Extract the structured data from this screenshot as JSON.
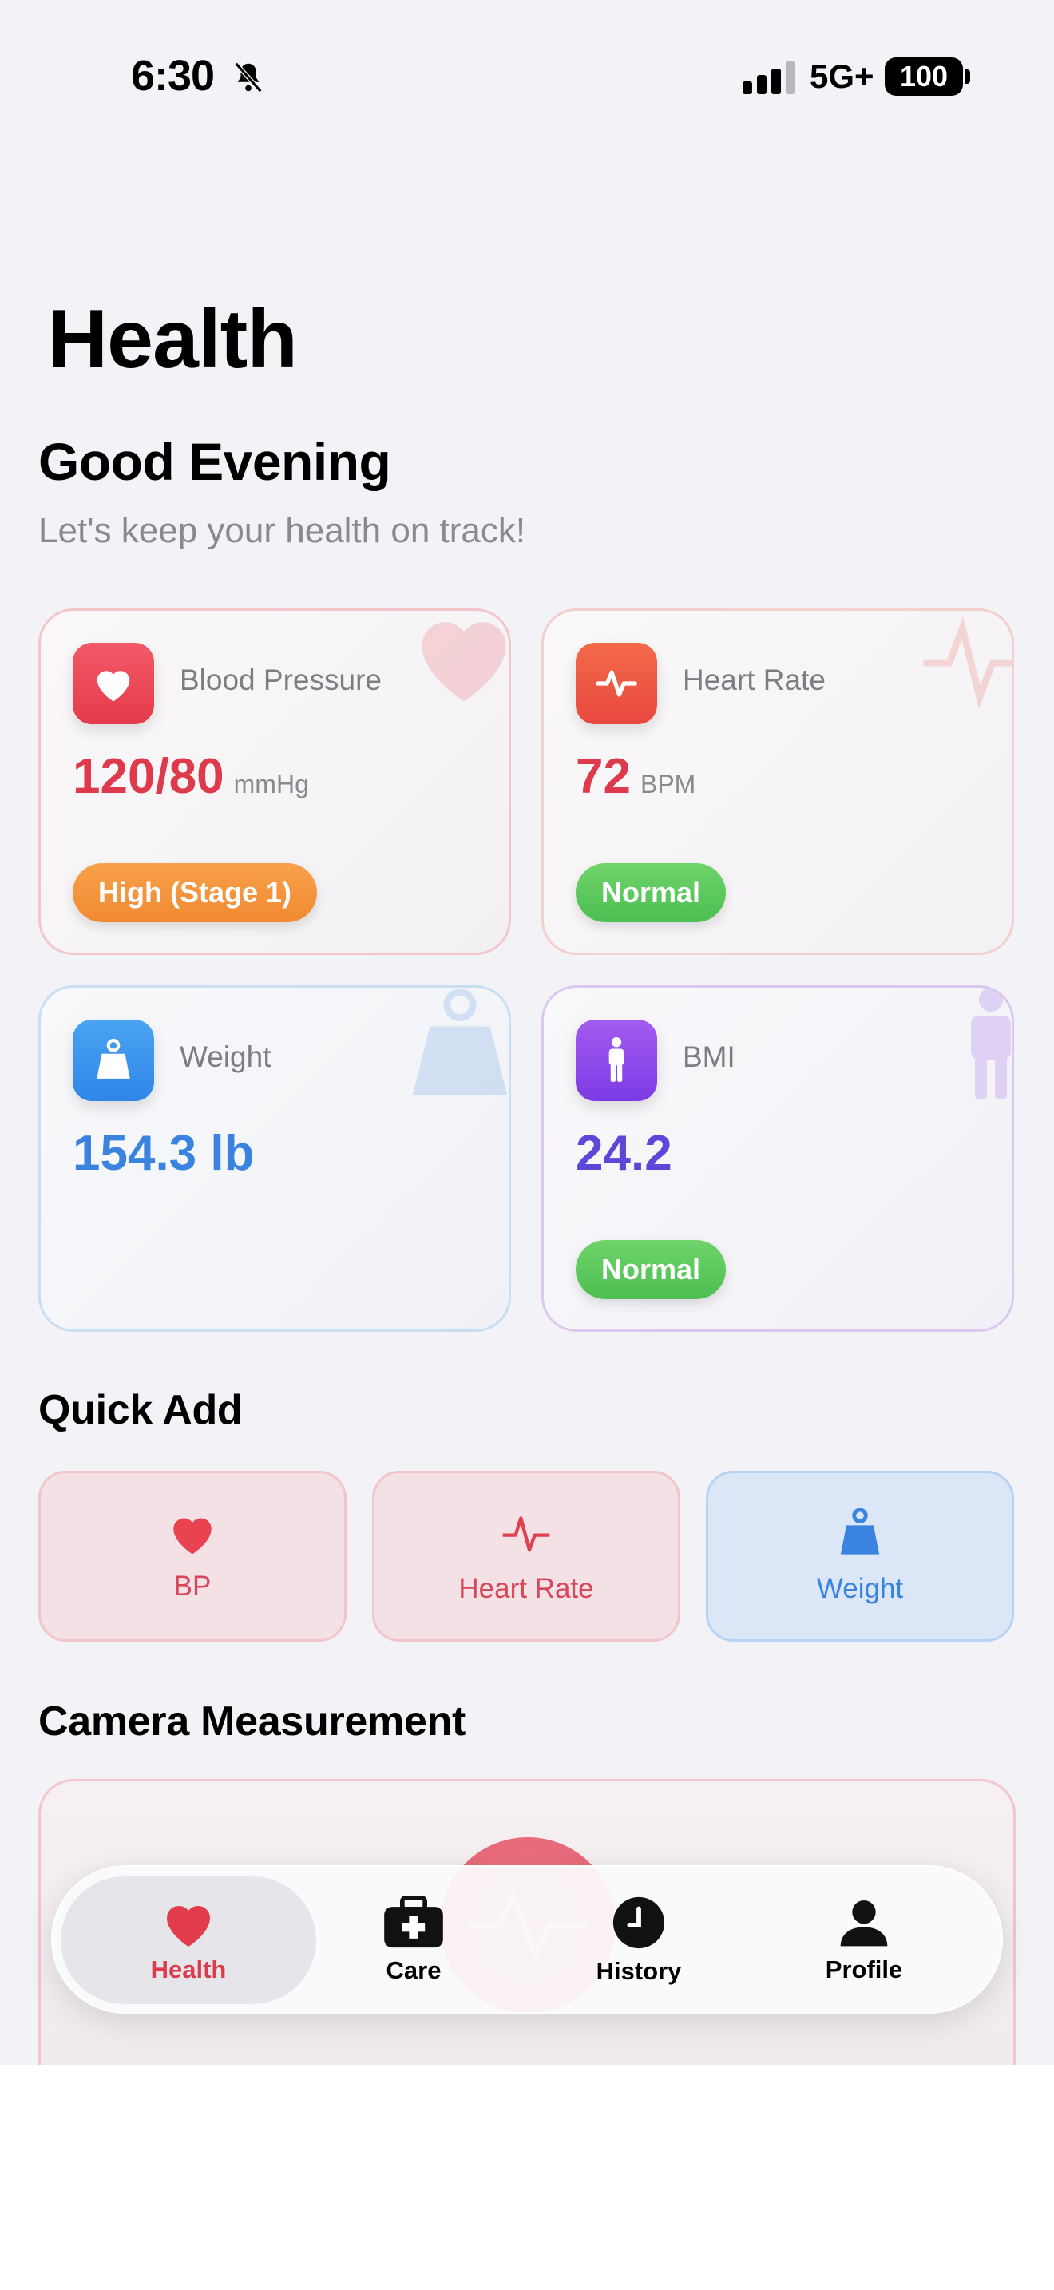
{
  "status_bar": {
    "time": "6:30",
    "network": "5G+",
    "battery": "100"
  },
  "page_title": "Health",
  "greeting": "Good Evening",
  "subtitle": "Let's keep your health on track!",
  "metrics": {
    "blood_pressure": {
      "label": "Blood Pressure",
      "value": "120/80",
      "unit": "mmHg",
      "status": "High (Stage 1)",
      "icon": "heart-icon"
    },
    "heart_rate": {
      "label": "Heart Rate",
      "value": "72",
      "unit": "BPM",
      "status": "Normal",
      "icon": "pulse-icon"
    },
    "weight": {
      "label": "Weight",
      "value": "154.3 lb",
      "icon": "weight-icon"
    },
    "bmi": {
      "label": "BMI",
      "value": "24.2",
      "status": "Normal",
      "icon": "person-icon"
    }
  },
  "quick_add": {
    "title": "Quick Add",
    "items": [
      {
        "label": "BP",
        "icon": "heart-icon"
      },
      {
        "label": "Heart Rate",
        "icon": "pulse-icon"
      },
      {
        "label": "Weight",
        "icon": "weight-icon"
      }
    ]
  },
  "camera": {
    "title": "Camera Measurement"
  },
  "tabs": [
    {
      "label": "Health",
      "icon": "heart-icon",
      "active": true
    },
    {
      "label": "Care",
      "icon": "medkit-icon"
    },
    {
      "label": "History",
      "icon": "clock-icon"
    },
    {
      "label": "Profile",
      "icon": "person-icon"
    }
  ],
  "colors": {
    "accent_red": "#dd3b4c",
    "accent_blue": "#3a84e0",
    "accent_purple": "#5b48d8",
    "status_orange": "#f08a32",
    "status_green": "#4cbf52"
  }
}
